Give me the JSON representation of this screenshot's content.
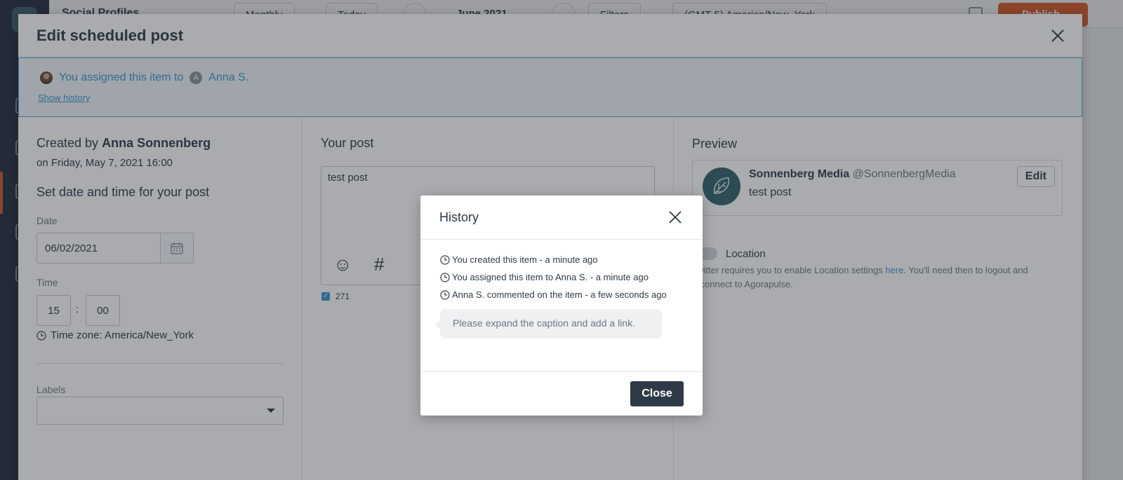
{
  "background": {
    "title": "Social Profiles",
    "view_select": "Monthly",
    "today_button": "Today",
    "month": "June 2021",
    "filters_button": "Filters",
    "timezone_select": "(GMT-5) America/New_York",
    "publish_button": "Publish"
  },
  "edit_modal": {
    "title": "Edit scheduled post",
    "assign_banner": {
      "text": "You assigned this item to",
      "assignee_initial": "A",
      "assignee": "Anna S.",
      "show_history": "Show history"
    },
    "left": {
      "created_by_prefix": "Created by",
      "created_by_name": "Anna Sonnenberg",
      "created_on": "on Friday, May 7, 2021 16:00",
      "set_date_heading": "Set date and time for your post",
      "date_label": "Date",
      "date_value": "06/02/2021",
      "time_label": "Time",
      "hour": "15",
      "colon": ":",
      "minute": "00",
      "timezone": "Time zone: America/New_York",
      "labels_label": "Labels"
    },
    "middle": {
      "heading": "Your post",
      "post_text": "test post",
      "emoji_glyph": "☺",
      "hashtag_glyph": "#",
      "char_count": "271"
    },
    "right": {
      "heading": "Preview",
      "account_name": "Sonnenberg Media",
      "handle": "@SonnenbergMedia",
      "post_text": "test post",
      "edit_button": "Edit",
      "location_label": "Location",
      "location_note_before": "Twitter requires you to enable Location settings ",
      "location_note_link": "here",
      "location_note_after": ". You'll need then to logout and reconnect to Agorapulse."
    }
  },
  "history": {
    "title": "History",
    "entries": [
      "You created this item  - a minute ago",
      "You assigned this item to Anna S. - a minute ago",
      "Anna S. commented on the item  - a few seconds ago"
    ],
    "comment": "Please expand the caption and add a link.",
    "close_button": "Close"
  },
  "colors": {
    "accent_blue": "#3b93cf",
    "dark_button": "#2e3a48",
    "publish_orange": "#e25a26"
  }
}
